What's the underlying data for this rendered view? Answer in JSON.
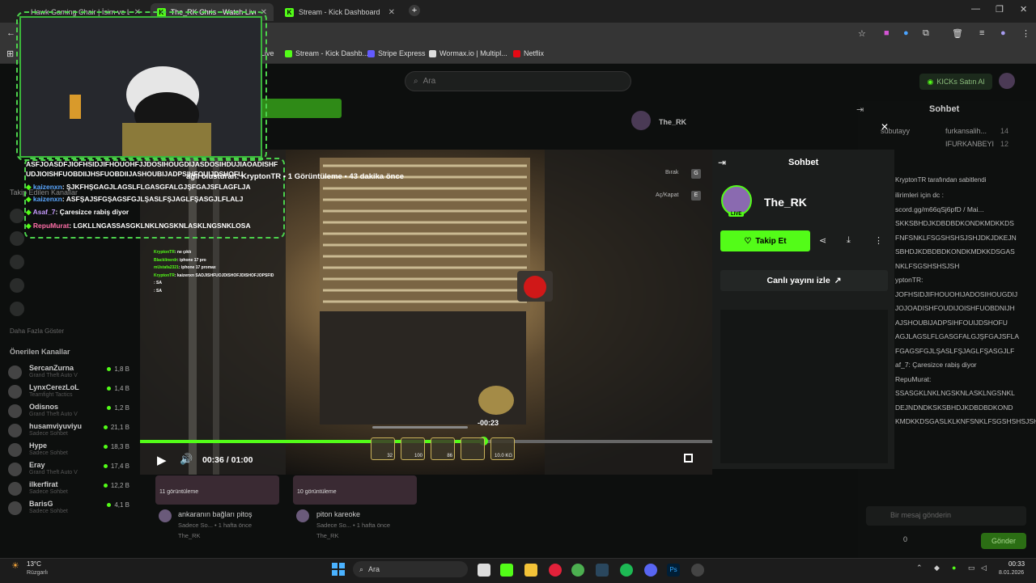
{
  "tabs": [
    {
      "label": "Hawk Gaming Chair | İsim ve L...",
      "active": false
    },
    {
      "label": "The_RK Chris - Watch Live",
      "active": true
    },
    {
      "label": "Stream - Kick Dashboard",
      "active": false
    }
  ],
  "bookmarks": [
    "Live",
    "Stream - Kick Dashb...",
    "Stripe Express",
    "Wormax.io | Multipl...",
    "Netflix"
  ],
  "search": {
    "placeholder": "Ara"
  },
  "kicks_button": "KICKs Satın Al",
  "sidebar": {
    "following_label": "Takip Edilen Kanallar",
    "more_label": "Daha Fazla Göster",
    "recommended_label": "Önerilen Kanallar",
    "recommended": [
      {
        "name": "SercanZurna",
        "game": "Grand Theft Auto V",
        "viewers": "1,8 B"
      },
      {
        "name": "LynxCerezLoL",
        "game": "Teamfight Tactics",
        "viewers": "1,4 B"
      },
      {
        "name": "Odisnos",
        "game": "Grand Theft Auto V",
        "viewers": "1,2 B"
      },
      {
        "name": "husamviyuviyu",
        "game": "Sadece Sohbet",
        "viewers": "21,1 B"
      },
      {
        "name": "Hype",
        "game": "Sadece Sohbet",
        "viewers": "18,3 B"
      },
      {
        "name": "Eray",
        "game": "Grand Theft Auto V",
        "viewers": "17,4 B"
      },
      {
        "name": "ilkerfirat",
        "game": "Sadece Sohbet",
        "viewers": "12,2 B"
      },
      {
        "name": "BarisG",
        "game": "Sadece Sohbet",
        "viewers": "4,1 B"
      }
    ]
  },
  "overlay_chat": [
    {
      "user": "",
      "text": "ASFJOASDFJIOFHSIDJIFHOUOHFJJDOSIHOUGDIJASDOSIHDUJIAOADISHF"
    },
    {
      "user": "",
      "text": "UDJIOISHFUOBDIIJHSFUOBDIIJASHOUBIJADPSIHFOUIJDSHOFU"
    },
    {
      "user": "",
      "text": "aglı olusturan: KryptonTR • 1 Görüntüleme • 43 dakika önce"
    },
    {
      "user": "kaizenxn",
      "text": ": ŞJKFHŞGAGJLAGSLFLGASGFALGJŞFGAJSFLAGFLJA"
    },
    {
      "user": "kaizenxn",
      "text": ": ASFŞAJSFGŞAGSFGJLŞASLFŞJAGLFŞASGJLFLALJ"
    },
    {
      "user": "Asaf_7",
      "text": ": Çaresizce rabiş diyor"
    },
    {
      "user": "RepuMurat",
      "text": ": LGKLLNGASSASGKLNKLNGSKNLASKLNGSNKLOSA"
    }
  ],
  "mini_chat": [
    {
      "user": "KryptonTR",
      "text": ": ne çıktı"
    },
    {
      "user": "Blacklinerdr",
      "text": ": iphone 17 pro"
    },
    {
      "user": "mUstafa2321",
      "text": ": iphone 17 promax"
    },
    {
      "user": "KryptonTR",
      "text": ": kaizenxn SADJISHFUOJDISHOFJDISHOFJOPSFID"
    },
    {
      "user": "",
      "text": ": SA"
    },
    {
      "user": "",
      "text": ": SA"
    }
  ],
  "stream_info": {
    "channel": "The_RK"
  },
  "player": {
    "time": "00:36 / 01:00",
    "scrub_label": "-00:23",
    "progress": 0.6,
    "hotbar": [
      "32",
      "100",
      "86",
      "",
      "10.0 KG"
    ]
  },
  "game_overlay": [
    "Bırak",
    "Aç/Kapat",
    "G",
    "E"
  ],
  "panel": {
    "chat_title": "Sohbet",
    "channel_name": "The_RK",
    "live_badge": "LIVE",
    "follow_button": "Takip Et",
    "watch_live": "Canlı yayını izle"
  },
  "right_chat": {
    "title": "Sohbet",
    "pinned": "KryptonTR tarafından sabitlendi",
    "subs": [
      {
        "name": "subutayy",
        "count": "12"
      },
      {
        "name": "furkansalih...",
        "count": "14"
      },
      {
        "name": "IFURKANBEYI",
        "count": "12"
      }
    ],
    "lines": [
      "ilirimleri için dc :",
      "scord.gg/m66qSj6pfD / Mai...",
      "SKKSBHDJKDBDBDKONDKMDKKDS",
      "FNFSNKLFSGSHSHSJSHJDKJDKEJN",
      "SBHDJKDBDBDKONDKMDKKDSGAS",
      "NKLFSGSHSHSJSH",
      "yptonTR:",
      "JOFHSIDJIFHOUOHIJADOSIHOUGDIJ",
      "JOJOADISHFOUDIJOISHFUOBDNIJH",
      "AJSHOUBIJADPSIHFOUIJDSHOFU",
      "AGJLAGSLFLGASGFALGJŞFGAJSFLA",
      "FGAGSFGJLŞASLFŞJAGLFŞASGJLF",
      "af_7: Çaresizce rabiş diyor",
      "RepuMurat:",
      "SSASGKLNKLNGSKNLASKLNGSNKL",
      "DEJNDNDKSKSBHDJKDBDBDKOND",
      "KMDKKDSGASLKLKNFSNKLFSGSHSHSJSH"
    ],
    "message_placeholder": "Bir mesaj gönderin",
    "points": "0",
    "send_button": "Gönder"
  },
  "recommended_videos": [
    {
      "views": "11 görüntüleme",
      "title": "ankaranın bağları pitoş",
      "sub": "Sadece So... • 1 hafta önce",
      "channel": "The_RK"
    },
    {
      "views": "10 görüntüleme",
      "title": "piton kareoke",
      "sub": "Sadece So... • 1 hafta önce",
      "channel": "The_RK"
    }
  ],
  "taskbar": {
    "weather_temp": "13°C",
    "weather_desc": "Rüzgarlı",
    "search": "Ara",
    "time": "00:33",
    "date": "8.01.2026"
  },
  "colors": {
    "accent": "#53fc18",
    "panel": "#1b1d1c"
  }
}
